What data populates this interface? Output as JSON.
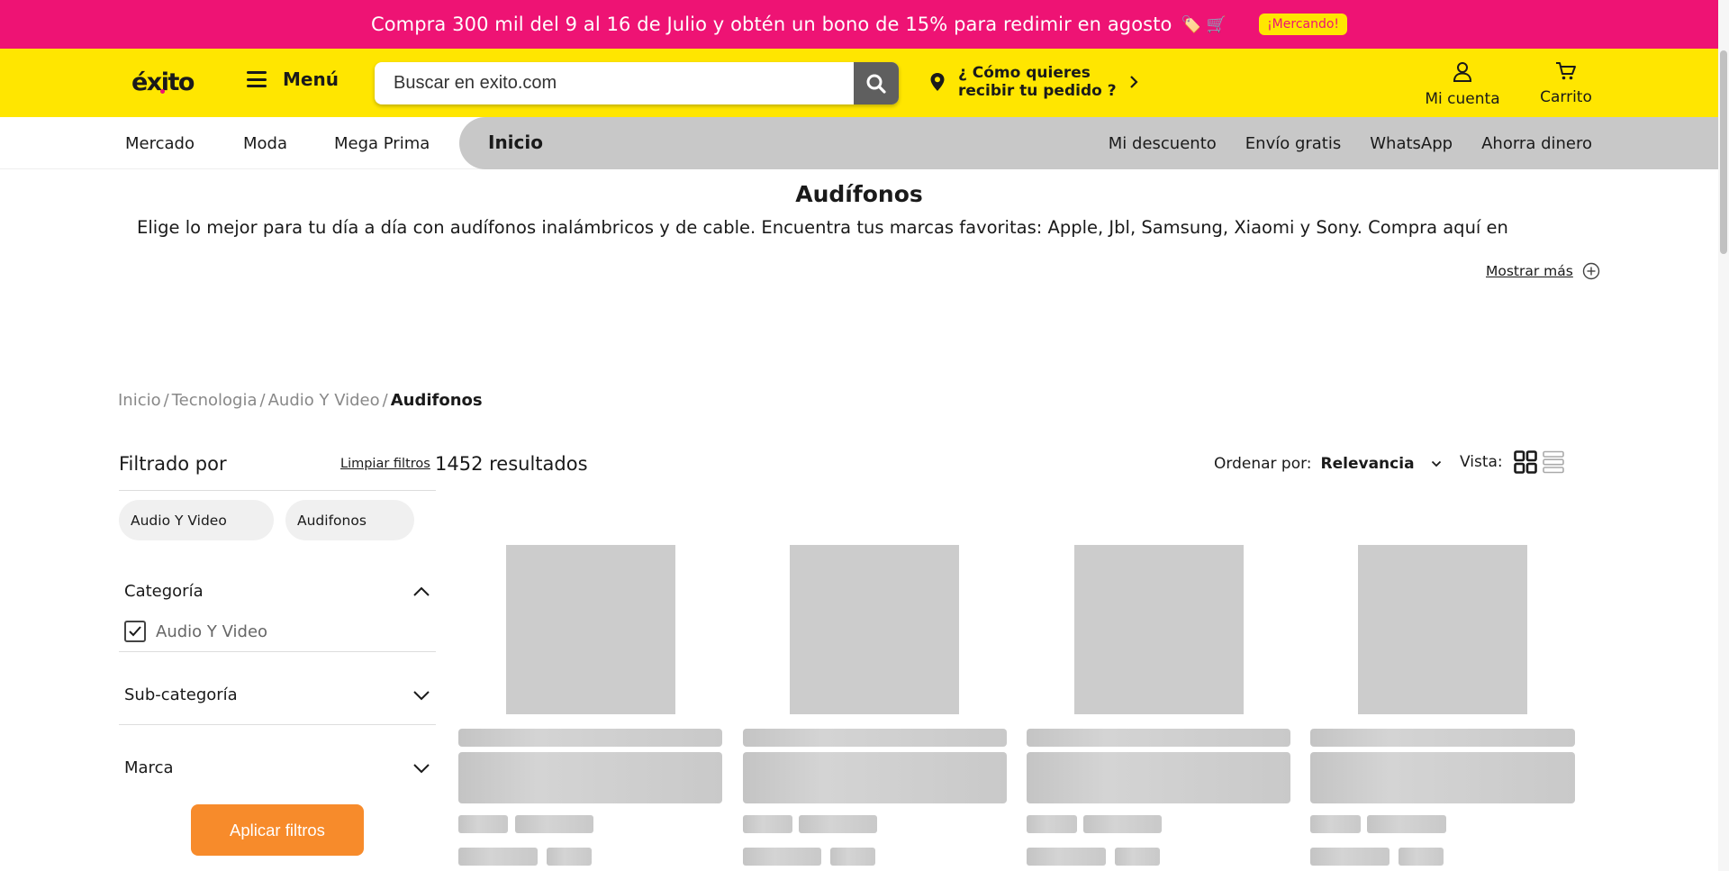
{
  "promo": {
    "text": "Compra 300 mil del 9 al 16 de Julio y obtén un bono de 15% para redimir en agosto",
    "emoji": "🏷️ 🛒",
    "badge": "¡Mercando!",
    "bg_color": "#EE1374"
  },
  "header": {
    "logo": "éxito",
    "menu_label": "Menú",
    "search_placeholder": "Buscar en exito.com",
    "delivery_line1": "¿ Cómo quieres",
    "delivery_line2": "recibir tu pedido ?",
    "account_label": "Mi cuenta",
    "cart_label": "Carrito",
    "bg_color": "#FFE600"
  },
  "nav": {
    "left_items": [
      "Mercado",
      "Moda",
      "Mega Prima"
    ],
    "active": "Inicio",
    "right_items": [
      "Mi descuento",
      "Envío gratis",
      "WhatsApp",
      "Ahorra dinero"
    ]
  },
  "category": {
    "title": "Audífonos",
    "description": "Elige lo mejor para tu día a día con audífonos inalámbricos y de cable. Encuentra tus marcas favoritas: Apple, Jbl, Samsung, Xiaomi y Sony. Compra aquí en",
    "show_more": "Mostrar más"
  },
  "breadcrumb": {
    "items": [
      "Inicio",
      "Tecnologia",
      "Audio Y Video"
    ],
    "current": "Audifonos"
  },
  "filters": {
    "title": "Filtrado por",
    "clear": "Limpiar filtros",
    "chips": [
      "Audio Y Video",
      "Audifonos"
    ],
    "facets": {
      "categoria": "Categoría",
      "categoria_option": "Audio Y Video",
      "subcategoria": "Sub-categoría",
      "marca": "Marca"
    },
    "apply": "Aplicar filtros",
    "apply_color": "#F78B2B"
  },
  "results": {
    "count": "1452 resultados",
    "sort_label": "Ordenar por:",
    "sort_value": "Relevancia",
    "view_label": "Vista:"
  }
}
